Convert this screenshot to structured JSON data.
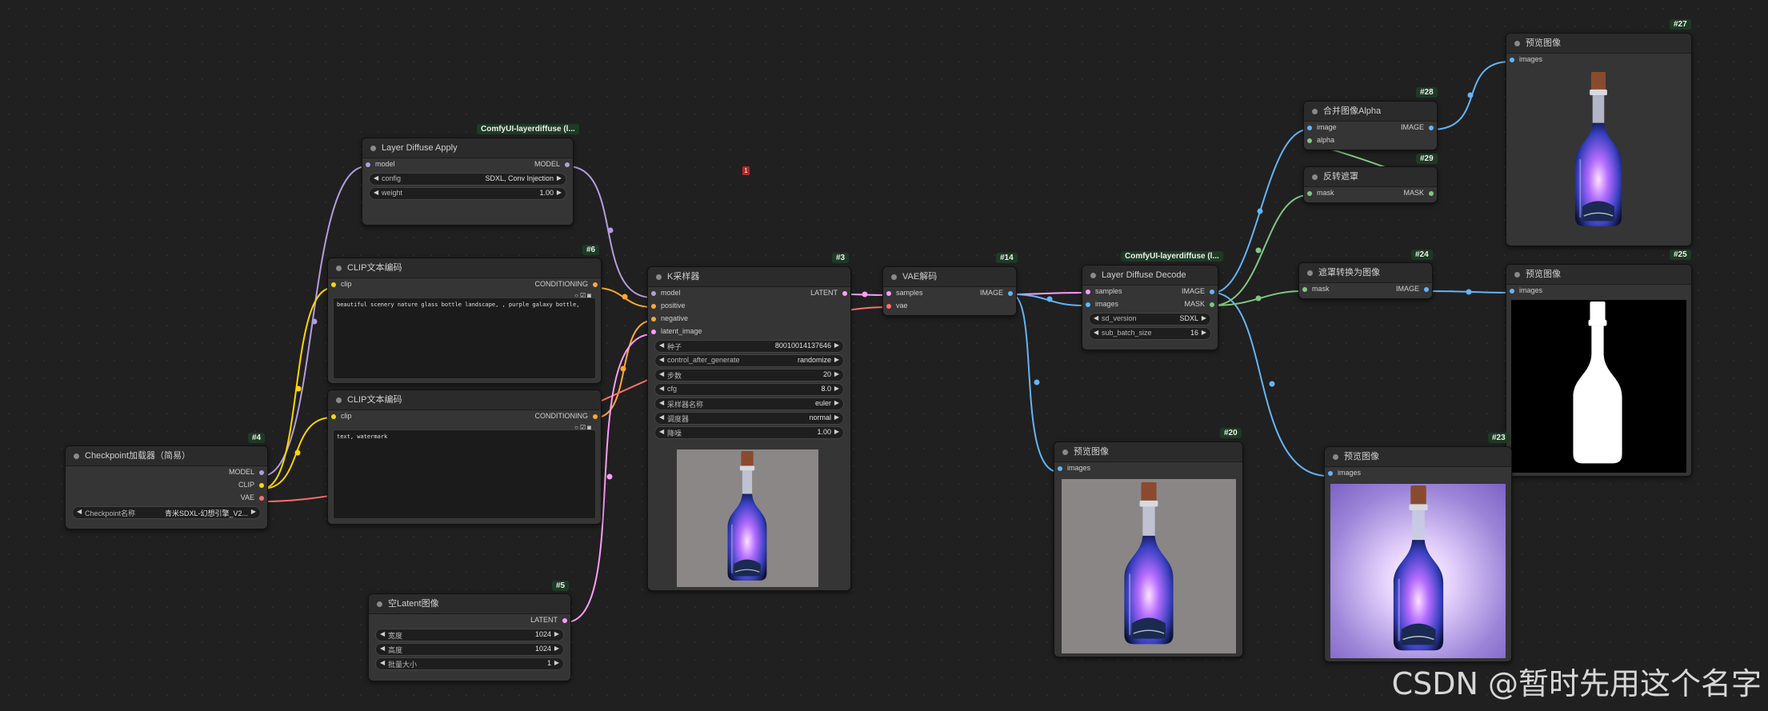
{
  "nodes": {
    "layer_diffuse_apply": {
      "group": "ComfyUI-layerdiffuse (l...",
      "title": "Layer Diffuse Apply",
      "in_model": "model",
      "out_model": "MODEL",
      "config_label": "config",
      "config_value": "SDXL, Conv Injection",
      "weight_label": "weight",
      "weight_value": "1.00"
    },
    "clip_text_pos": {
      "id": "#6",
      "title": "CLIP文本编码",
      "in_clip": "clip",
      "out": "CONDITIONING",
      "text": "beautiful scenery nature glass bottle landscape, , purple galaxy bottle,"
    },
    "clip_text_neg": {
      "title": "CLIP文本编码",
      "in_clip": "clip",
      "out": "CONDITIONING",
      "text": "text, watermark"
    },
    "checkpoint": {
      "id": "#4",
      "title": "Checkpoint加载器（简易）",
      "out_model": "MODEL",
      "out_clip": "CLIP",
      "out_vae": "VAE",
      "ckpt_label": "Checkpoint名称",
      "ckpt_value": "青米SDXL-幻想引擎_V2..."
    },
    "empty_latent": {
      "id": "#5",
      "title": "空Latent图像",
      "out": "LATENT",
      "width_label": "宽度",
      "width_value": "1024",
      "height_label": "高度",
      "height_value": "1024",
      "batch_label": "批量大小",
      "batch_value": "1"
    },
    "ksampler": {
      "id": "#3",
      "title": "K采样器",
      "in_model": "model",
      "in_positive": "positive",
      "in_negative": "negative",
      "in_latent": "latent_image",
      "out": "LATENT",
      "seed_label": "种子",
      "seed_value": "800100141376​46",
      "ctrl_label": "control_after_generate",
      "ctrl_value": "randomize",
      "steps_label": "步数",
      "steps_value": "20",
      "cfg_label": "cfg",
      "cfg_value": "8.0",
      "sampler_label": "采样器名称",
      "sampler_value": "euler",
      "sched_label": "调度器",
      "sched_value": "normal",
      "denoise_label": "降噪",
      "denoise_value": "1.00"
    },
    "vae_decode": {
      "id": "#14",
      "title": "VAE解码",
      "in_samples": "samples",
      "in_vae": "vae",
      "out": "IMAGE"
    },
    "layer_diffuse_decode": {
      "group": "ComfyUI-layerdiffuse (l...",
      "title": "Layer Diffuse Decode",
      "in_samples": "samples",
      "in_images": "images",
      "out_image": "IMAGE",
      "out_mask": "MASK",
      "sd_label": "sd_version",
      "sd_value": "SDXL",
      "batch_label": "sub_batch_size",
      "batch_value": "16"
    },
    "join_alpha": {
      "id": "#28",
      "title": "合并图像Alpha",
      "in_image": "image",
      "in_alpha": "alpha",
      "out": "IMAGE"
    },
    "invert_mask": {
      "id": "#29",
      "title": "反转遮罩",
      "in_mask": "mask",
      "out": "MASK"
    },
    "mask_to_image": {
      "id": "#24",
      "title": "遮罩转换为图像",
      "in_mask": "mask",
      "out": "IMAGE"
    },
    "preview_27": {
      "id": "#27",
      "title": "预览图像",
      "in": "images"
    },
    "preview_25": {
      "id": "#25",
      "title": "预览图像",
      "in": "images"
    },
    "preview_20": {
      "id": "#20",
      "title": "预览图像",
      "in": "images"
    },
    "preview_23": {
      "id": "#23",
      "title": "预览图像",
      "in": "images"
    }
  },
  "marker": "1",
  "watermark": "CSDN @暂时先用这个名字",
  "colors": {
    "model": "#b39ddb",
    "clip": "#ffd500",
    "conditioning": "#ffa931",
    "latent": "#ff9cf9",
    "vae": "#ff6e6e",
    "image": "#64b5f6",
    "mask": "#81c784"
  }
}
